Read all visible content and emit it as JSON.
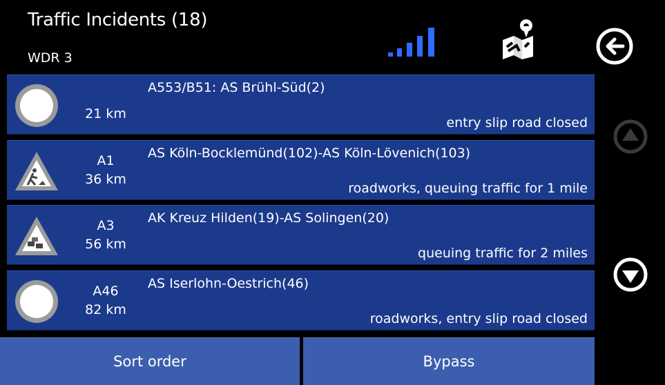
{
  "header": {
    "title": "Traffic Incidents (18)",
    "station": "WDR 3",
    "signal_icon": "signal-strength-icon",
    "map_icon": "map-route-icon",
    "back_icon": "back-arrow-icon"
  },
  "incidents": [
    {
      "icon": "warning-circle-icon",
      "road": "",
      "distance": "21 km",
      "location": "A553/B51: AS Brühl-Süd(2)",
      "description": "entry slip road closed"
    },
    {
      "icon": "roadworks-sign-icon",
      "road": "A1",
      "distance": "36 km",
      "location": "AS Köln-Bocklemünd(102)-AS Köln-Lövenich(103)",
      "description": "roadworks, queuing traffic for 1 mile"
    },
    {
      "icon": "queuing-traffic-sign-icon",
      "road": "A3",
      "distance": "56 km",
      "location": "AK Kreuz Hilden(19)-AS Solingen(20)",
      "description": "queuing traffic for 2 miles"
    },
    {
      "icon": "warning-circle-icon",
      "road": "A46",
      "distance": "82 km",
      "location": "AS Iserlohn-Oestrich(46)",
      "description": "roadworks, entry slip road closed"
    }
  ],
  "buttons": {
    "sort": "Sort order",
    "bypass": "Bypass"
  },
  "colors": {
    "row_bg": "#1c3a8c",
    "button_bg": "#3b5fae",
    "signal": "#2f6bff",
    "background": "#000000"
  }
}
